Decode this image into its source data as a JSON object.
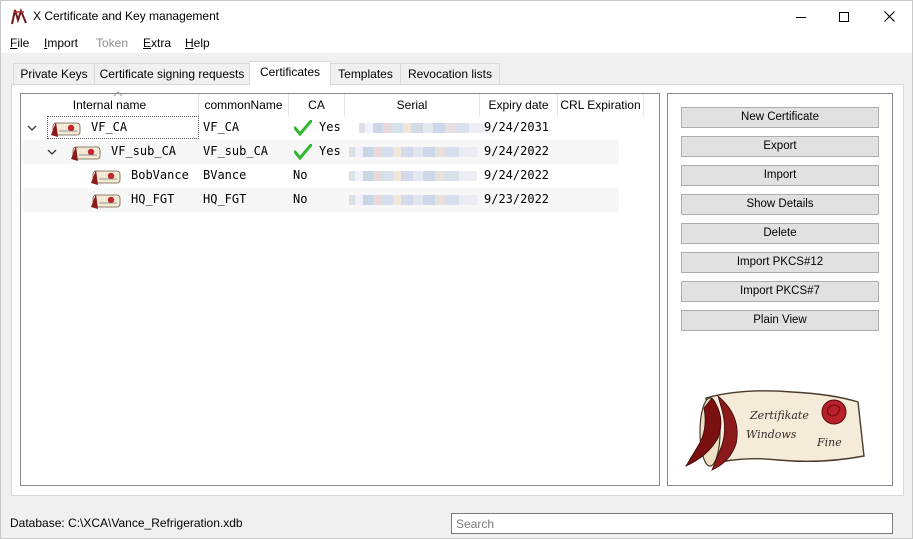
{
  "window": {
    "title": "X Certificate and Key management"
  },
  "menu": {
    "items": [
      {
        "label": "File",
        "mnemonic": "F",
        "rest": "ile",
        "disabled": false
      },
      {
        "label": "Import",
        "mnemonic": "I",
        "rest": "mport",
        "disabled": false
      },
      {
        "label": "Token",
        "mnemonic": "",
        "rest": "Token",
        "disabled": true
      },
      {
        "label": "Extra",
        "mnemonic": "E",
        "rest": "xtra",
        "disabled": false
      },
      {
        "label": "Help",
        "mnemonic": "H",
        "rest": "elp",
        "disabled": false
      }
    ]
  },
  "tabs": [
    {
      "label": "Private Keys",
      "active": false
    },
    {
      "label": "Certificate signing requests",
      "active": false
    },
    {
      "label": "Certificates",
      "active": true
    },
    {
      "label": "Templates",
      "active": false
    },
    {
      "label": "Revocation lists",
      "active": false
    }
  ],
  "table": {
    "columns": [
      "Internal name",
      "commonName",
      "CA",
      "Serial",
      "Expiry date",
      "CRL Expiration"
    ],
    "rows": [
      {
        "internal_name": "VF_CA",
        "common_name": "VF_CA",
        "ca": "Yes",
        "ca_check": true,
        "expiry": "9/24/2031",
        "crl": "",
        "depth": 0,
        "expanded": true
      },
      {
        "internal_name": "VF_sub_CA",
        "common_name": "VF_sub_CA",
        "ca": "Yes",
        "ca_check": true,
        "expiry": "9/24/2022",
        "crl": "",
        "depth": 1,
        "expanded": true
      },
      {
        "internal_name": "BobVance",
        "common_name": "BVance",
        "ca": "No",
        "ca_check": false,
        "expiry": "9/24/2022",
        "crl": "",
        "depth": 2,
        "expanded": false
      },
      {
        "internal_name": "HQ_FGT",
        "common_name": "HQ_FGT",
        "ca": "No",
        "ca_check": false,
        "expiry": "9/23/2022",
        "crl": "",
        "depth": 2,
        "expanded": false
      }
    ]
  },
  "buttons": [
    "New Certificate",
    "Export",
    "Import",
    "Show Details",
    "Delete",
    "Import PKCS#12",
    "Import PKCS#7",
    "Plain View"
  ],
  "logo": {
    "line1": "Zertifikate",
    "line2": "Windows",
    "line3": "Fine"
  },
  "status": {
    "database": "Database: C:\\XCA\\Vance_Refrigeration.xdb"
  },
  "search": {
    "placeholder": "Search",
    "value": ""
  },
  "colors": {
    "accent_red": "#8b1a1a",
    "check_green": "#2eb82e",
    "panel_border": "#828790"
  }
}
